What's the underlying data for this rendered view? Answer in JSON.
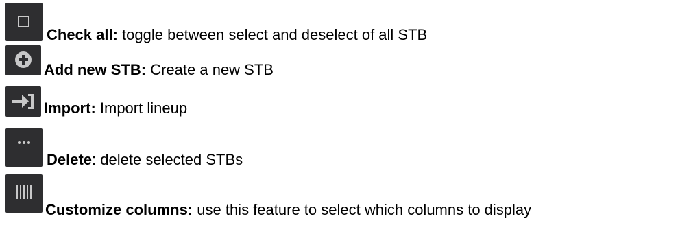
{
  "items": [
    {
      "icon": "checkbox-icon",
      "term": "Check all:",
      "description": " toggle between select and deselect of all STB"
    },
    {
      "icon": "add-circle-icon",
      "term": "Add new STB:",
      "description": " Create a new STB"
    },
    {
      "icon": "import-icon",
      "term": "Import:",
      "description": " Import lineup"
    },
    {
      "icon": "more-dots-icon",
      "term": "Delete",
      "description": ": delete selected STBs"
    },
    {
      "icon": "columns-icon",
      "term": "Customize columns:",
      "description": " use this feature to select which columns to display"
    }
  ],
  "colors": {
    "icon_background": "#2e2e30",
    "icon_foreground": "#c8c8c8",
    "text": "#000000"
  }
}
